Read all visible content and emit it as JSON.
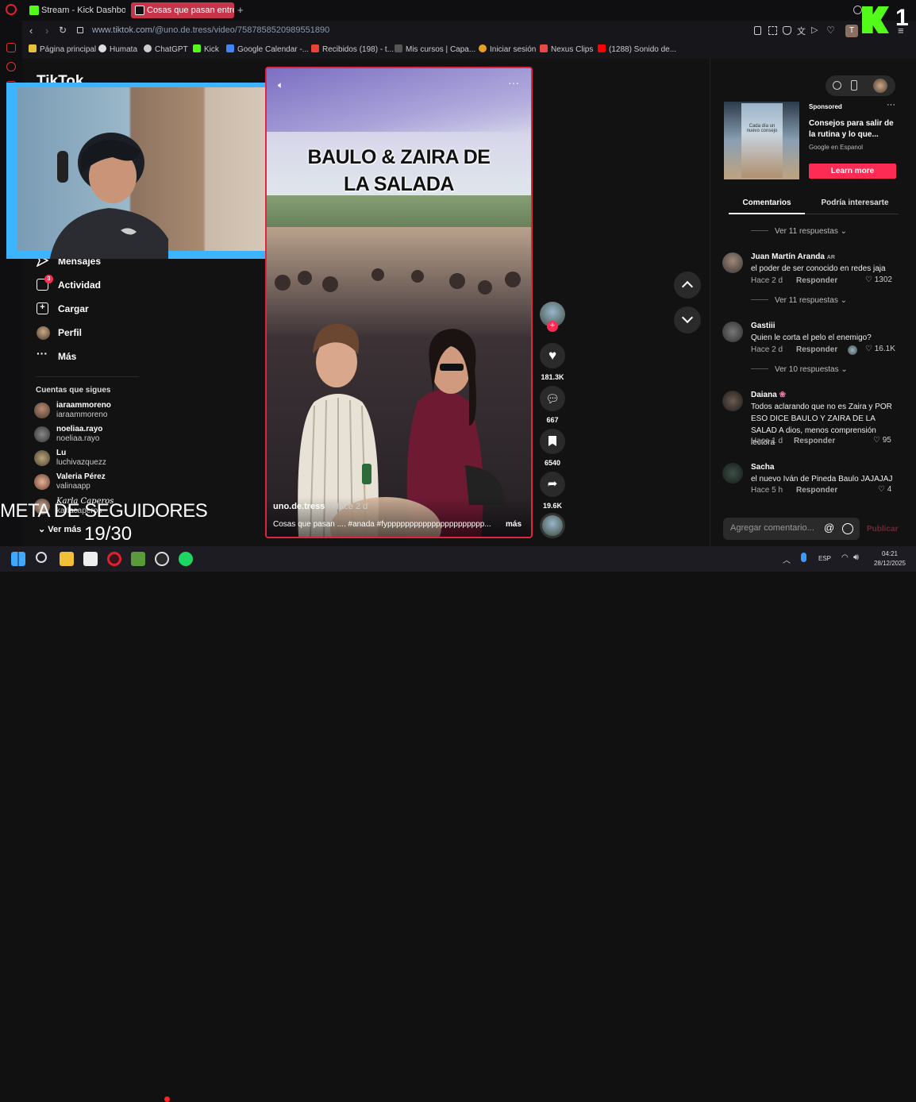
{
  "browser": {
    "tabs": [
      {
        "label": "Stream - Kick Dashboard",
        "color": "#53fc18"
      },
      {
        "label": "Cosas que pasan entre Ba",
        "color": "#111111",
        "active": true
      }
    ],
    "new_tab_symbol": "+",
    "url_prefix": "www.tiktok.com",
    "url_suffix": "/@uno.de.tress/video/7587858520989551890",
    "bookmarks": [
      "Página principal",
      "Humata",
      "ChatGPT",
      "Kick",
      "Google Calendar -...",
      "Recibidos (198) - t...",
      "Mis cursos | Capa...",
      "Iniciar sesión",
      "Nexus Clips",
      "(1288) Sonido de..."
    ],
    "profile_initial": "T"
  },
  "tiktok": {
    "logo": "TikTok",
    "nav": [
      {
        "label": "Mensajes",
        "icon": "send-icon"
      },
      {
        "label": "Actividad",
        "icon": "inbox-icon",
        "badge": "3"
      },
      {
        "label": "Cargar",
        "icon": "plus-box-icon"
      },
      {
        "label": "Perfil",
        "icon": "avatar-icon"
      },
      {
        "label": "Más",
        "icon": "more-icon"
      }
    ],
    "following_title": "Cuentas que sigues",
    "following": [
      {
        "name": "iaraammoreno",
        "user": "iaraammoreno"
      },
      {
        "name": "noeliaa.rayo",
        "user": "noeliaa.rayo"
      },
      {
        "name": "Lu",
        "user": "luchivazquezz"
      },
      {
        "name": "Valeria Pérez",
        "user": "valinaapp"
      },
      {
        "name": "Karla Caperos",
        "user": "karlacaperos"
      }
    ],
    "see_more": "Ver más",
    "video": {
      "title_line1": "BAULO & ZAIRA DE",
      "title_line2": "LA SALADA",
      "author": "uno.de.tress",
      "time": "Hace 2 d",
      "caption": "Cosas que pasan .... #anada #fypppppppppppppppppppppp...",
      "more": "más"
    },
    "actions": {
      "likes": "181.3K",
      "comments": "667",
      "saves": "6540",
      "shares": "19.6K"
    }
  },
  "sidepanel": {
    "ad": {
      "sponsored": "Sponsored",
      "title": "Consejos para salir de la rutina y lo que...",
      "source": "Google en Espanol",
      "cta": "Learn more",
      "thumb_text": "Cada día un nuevo consejo"
    },
    "tabs": [
      "Comentarios",
      "Podría interesarte"
    ],
    "comments": [
      {
        "replies_above": "Ver 11 respuestas",
        "name": "Juan Martín Aranda",
        "flag": "AR",
        "text": "el poder de ser conocido en redes jaja",
        "time": "Hace 2 d",
        "reply": "Responder",
        "likes": "1302"
      },
      {
        "replies_above": "Ver 11 respuestas",
        "name": "Gastiii",
        "flag": "",
        "text": "Quien le corta el pelo el enemigo?",
        "time": "Hace 2 d",
        "reply": "Responder",
        "likes": "16.1K"
      },
      {
        "replies_above": "Ver 10 respuestas",
        "name": "Daiana",
        "flag": "",
        "text": "Todos aclarando que no es Zaira y POR ESO DICE BAULO Y ZAIRA DE LA SALAD A dios, menos comprensión lectora",
        "time": "Hace 1 d",
        "reply": "Responder",
        "likes": "95"
      },
      {
        "replies_above": "",
        "name": "Sacha",
        "flag": "",
        "text": "el nuevo Iván de Pineda Baulo JAJAJAJ",
        "time": "Hace 5 h",
        "reply": "Responder",
        "likes": "4"
      }
    ],
    "comment_placeholder": "Agregar comentario...",
    "publish": "Publicar"
  },
  "overlay": {
    "goal_label": "META DE SEGUIDORES",
    "goal_value": "19/30",
    "kick_badge": "1"
  },
  "taskbar": {
    "lang": "ESP",
    "time": "04:21",
    "date": "28/12/2025"
  }
}
